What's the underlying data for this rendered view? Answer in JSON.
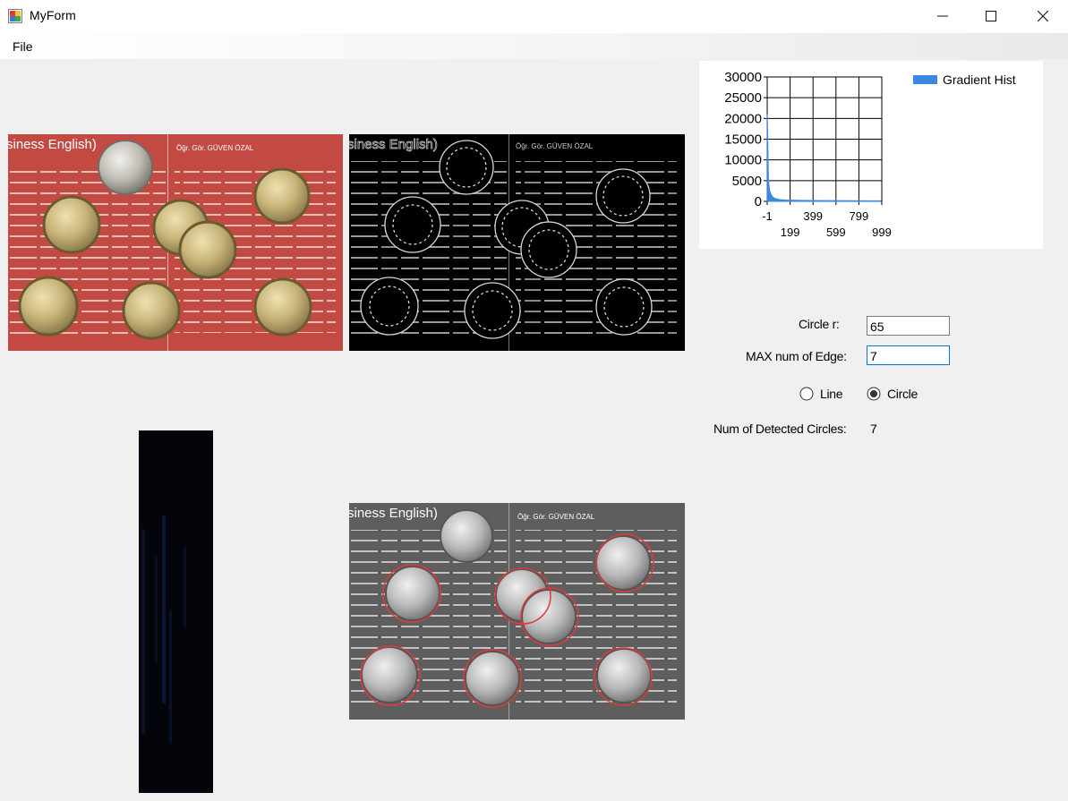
{
  "window": {
    "title": "MyForm"
  },
  "menu": {
    "file_label": "File"
  },
  "images": {
    "original_title_left": "siness English)",
    "original_title_right": "Öğr. Gör. GÜVEN ÖZAL",
    "edges_title_left": "siness English)",
    "edges_title_right": "Öğr. Gör. GÜVEN ÖZAL",
    "result_title_left": "siness English)",
    "result_title_right": "Öğr. Gör. GÜVEN ÖZAL"
  },
  "chart_data": {
    "type": "bar",
    "legend": "Gradient Hist",
    "legend_position": "top-right",
    "grid": true,
    "ylim": [
      0,
      30000
    ],
    "xlim": [
      -1,
      999
    ],
    "y_ticks": [
      "30000",
      "25000",
      "20000",
      "15000",
      "10000",
      "5000",
      "0"
    ],
    "x_ticks_row1": [
      "-1",
      "399",
      "799"
    ],
    "x_ticks_row2": [
      "199",
      "599",
      "999"
    ],
    "color": "#3d87e0",
    "x": [
      0,
      10,
      20,
      30,
      40,
      50,
      60,
      80,
      100,
      130,
      160,
      200,
      250,
      300,
      400,
      500,
      600,
      700,
      800,
      900,
      990
    ],
    "values": [
      21000,
      5200,
      2600,
      1800,
      1300,
      1000,
      800,
      600,
      450,
      380,
      330,
      300,
      260,
      240,
      220,
      200,
      180,
      160,
      150,
      140,
      130
    ]
  },
  "controls": {
    "circle_r_label": "Circle r:",
    "circle_r_value": "65",
    "max_edge_label": "MAX num of Edge:",
    "max_edge_value": "7",
    "radio_line_label": "Line",
    "radio_circle_label": "Circle",
    "radio_selected": "Circle",
    "detected_label": "Num of Detected Circles:",
    "detected_value": "7"
  }
}
